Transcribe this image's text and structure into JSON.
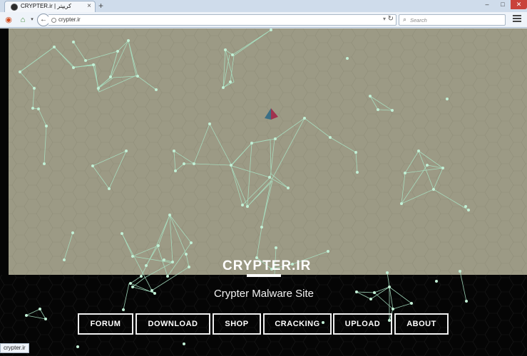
{
  "browser": {
    "tab_title": "CRYPTER.ir | کریپتر",
    "new_tab": "+",
    "url": "crypter.ir",
    "search_placeholder": "Search",
    "status_text": "crypter.ir"
  },
  "site": {
    "title": "CRYPTER.IR",
    "subtitle": "Crypter Malware Site"
  },
  "menu": {
    "forum": "FORUM",
    "download": "DOWNLOAD",
    "shop": "SHOP",
    "cracking": "CRACKING",
    "upload": "UPLOAD",
    "about": "ABOUT"
  },
  "colors": {
    "hero_background": "#9c9a85",
    "network_lines": "#a9e3c4",
    "button_border": "#f0f0f0"
  }
}
